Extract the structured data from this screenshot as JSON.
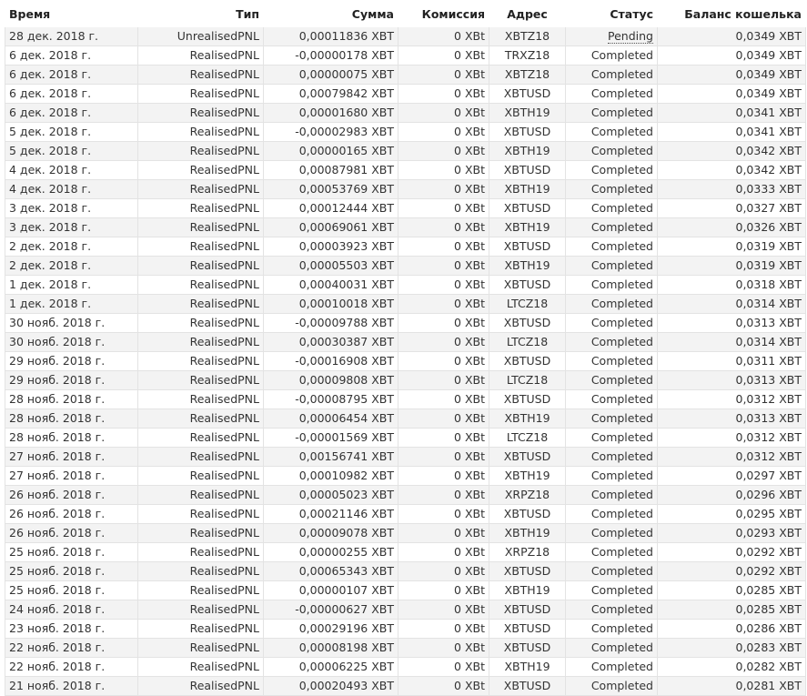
{
  "columns": {
    "time": "Время",
    "type": "Тип",
    "amount": "Сумма",
    "fee": "Комиссия",
    "address": "Адрес",
    "status": "Статус",
    "balance": "Баланс кошелька"
  },
  "rows": [
    {
      "time": "28 дек. 2018 г.",
      "type": "UnrealisedPNL",
      "amount": "0,00011836 XBT",
      "fee": "0 XBt",
      "address": "XBTZ18",
      "status": "Pending",
      "balance": "0,0349 XBT"
    },
    {
      "time": "6 дек. 2018 г.",
      "type": "RealisedPNL",
      "amount": "-0,00000178 XBT",
      "fee": "0 XBt",
      "address": "TRXZ18",
      "status": "Completed",
      "balance": "0,0349 XBT"
    },
    {
      "time": "6 дек. 2018 г.",
      "type": "RealisedPNL",
      "amount": "0,00000075 XBT",
      "fee": "0 XBt",
      "address": "XBTZ18",
      "status": "Completed",
      "balance": "0,0349 XBT"
    },
    {
      "time": "6 дек. 2018 г.",
      "type": "RealisedPNL",
      "amount": "0,00079842 XBT",
      "fee": "0 XBt",
      "address": "XBTUSD",
      "status": "Completed",
      "balance": "0,0349 XBT"
    },
    {
      "time": "6 дек. 2018 г.",
      "type": "RealisedPNL",
      "amount": "0,00001680 XBT",
      "fee": "0 XBt",
      "address": "XBTH19",
      "status": "Completed",
      "balance": "0,0341 XBT"
    },
    {
      "time": "5 дек. 2018 г.",
      "type": "RealisedPNL",
      "amount": "-0,00002983 XBT",
      "fee": "0 XBt",
      "address": "XBTUSD",
      "status": "Completed",
      "balance": "0,0341 XBT"
    },
    {
      "time": "5 дек. 2018 г.",
      "type": "RealisedPNL",
      "amount": "0,00000165 XBT",
      "fee": "0 XBt",
      "address": "XBTH19",
      "status": "Completed",
      "balance": "0,0342 XBT"
    },
    {
      "time": "4 дек. 2018 г.",
      "type": "RealisedPNL",
      "amount": "0,00087981 XBT",
      "fee": "0 XBt",
      "address": "XBTUSD",
      "status": "Completed",
      "balance": "0,0342 XBT"
    },
    {
      "time": "4 дек. 2018 г.",
      "type": "RealisedPNL",
      "amount": "0,00053769 XBT",
      "fee": "0 XBt",
      "address": "XBTH19",
      "status": "Completed",
      "balance": "0,0333 XBT"
    },
    {
      "time": "3 дек. 2018 г.",
      "type": "RealisedPNL",
      "amount": "0,00012444 XBT",
      "fee": "0 XBt",
      "address": "XBTUSD",
      "status": "Completed",
      "balance": "0,0327 XBT"
    },
    {
      "time": "3 дек. 2018 г.",
      "type": "RealisedPNL",
      "amount": "0,00069061 XBT",
      "fee": "0 XBt",
      "address": "XBTH19",
      "status": "Completed",
      "balance": "0,0326 XBT"
    },
    {
      "time": "2 дек. 2018 г.",
      "type": "RealisedPNL",
      "amount": "0,00003923 XBT",
      "fee": "0 XBt",
      "address": "XBTUSD",
      "status": "Completed",
      "balance": "0,0319 XBT"
    },
    {
      "time": "2 дек. 2018 г.",
      "type": "RealisedPNL",
      "amount": "0,00005503 XBT",
      "fee": "0 XBt",
      "address": "XBTH19",
      "status": "Completed",
      "balance": "0,0319 XBT"
    },
    {
      "time": "1 дек. 2018 г.",
      "type": "RealisedPNL",
      "amount": "0,00040031 XBT",
      "fee": "0 XBt",
      "address": "XBTUSD",
      "status": "Completed",
      "balance": "0,0318 XBT"
    },
    {
      "time": "1 дек. 2018 г.",
      "type": "RealisedPNL",
      "amount": "0,00010018 XBT",
      "fee": "0 XBt",
      "address": "LTCZ18",
      "status": "Completed",
      "balance": "0,0314 XBT"
    },
    {
      "time": "30 нояб. 2018 г.",
      "type": "RealisedPNL",
      "amount": "-0,00009788 XBT",
      "fee": "0 XBt",
      "address": "XBTUSD",
      "status": "Completed",
      "balance": "0,0313 XBT"
    },
    {
      "time": "30 нояб. 2018 г.",
      "type": "RealisedPNL",
      "amount": "0,00030387 XBT",
      "fee": "0 XBt",
      "address": "LTCZ18",
      "status": "Completed",
      "balance": "0,0314 XBT"
    },
    {
      "time": "29 нояб. 2018 г.",
      "type": "RealisedPNL",
      "amount": "-0,00016908 XBT",
      "fee": "0 XBt",
      "address": "XBTUSD",
      "status": "Completed",
      "balance": "0,0311 XBT"
    },
    {
      "time": "29 нояб. 2018 г.",
      "type": "RealisedPNL",
      "amount": "0,00009808 XBT",
      "fee": "0 XBt",
      "address": "LTCZ18",
      "status": "Completed",
      "balance": "0,0313 XBT"
    },
    {
      "time": "28 нояб. 2018 г.",
      "type": "RealisedPNL",
      "amount": "-0,00008795 XBT",
      "fee": "0 XBt",
      "address": "XBTUSD",
      "status": "Completed",
      "balance": "0,0312 XBT"
    },
    {
      "time": "28 нояб. 2018 г.",
      "type": "RealisedPNL",
      "amount": "0,00006454 XBT",
      "fee": "0 XBt",
      "address": "XBTH19",
      "status": "Completed",
      "balance": "0,0313 XBT"
    },
    {
      "time": "28 нояб. 2018 г.",
      "type": "RealisedPNL",
      "amount": "-0,00001569 XBT",
      "fee": "0 XBt",
      "address": "LTCZ18",
      "status": "Completed",
      "balance": "0,0312 XBT"
    },
    {
      "time": "27 нояб. 2018 г.",
      "type": "RealisedPNL",
      "amount": "0,00156741 XBT",
      "fee": "0 XBt",
      "address": "XBTUSD",
      "status": "Completed",
      "balance": "0,0312 XBT"
    },
    {
      "time": "27 нояб. 2018 г.",
      "type": "RealisedPNL",
      "amount": "0,00010982 XBT",
      "fee": "0 XBt",
      "address": "XBTH19",
      "status": "Completed",
      "balance": "0,0297 XBT"
    },
    {
      "time": "26 нояб. 2018 г.",
      "type": "RealisedPNL",
      "amount": "0,00005023 XBT",
      "fee": "0 XBt",
      "address": "XRPZ18",
      "status": "Completed",
      "balance": "0,0296 XBT"
    },
    {
      "time": "26 нояб. 2018 г.",
      "type": "RealisedPNL",
      "amount": "0,00021146 XBT",
      "fee": "0 XBt",
      "address": "XBTUSD",
      "status": "Completed",
      "balance": "0,0295 XBT"
    },
    {
      "time": "26 нояб. 2018 г.",
      "type": "RealisedPNL",
      "amount": "0,00009078 XBT",
      "fee": "0 XBt",
      "address": "XBTH19",
      "status": "Completed",
      "balance": "0,0293 XBT"
    },
    {
      "time": "25 нояб. 2018 г.",
      "type": "RealisedPNL",
      "amount": "0,00000255 XBT",
      "fee": "0 XBt",
      "address": "XRPZ18",
      "status": "Completed",
      "balance": "0,0292 XBT"
    },
    {
      "time": "25 нояб. 2018 г.",
      "type": "RealisedPNL",
      "amount": "0,00065343 XBT",
      "fee": "0 XBt",
      "address": "XBTUSD",
      "status": "Completed",
      "balance": "0,0292 XBT"
    },
    {
      "time": "25 нояб. 2018 г.",
      "type": "RealisedPNL",
      "amount": "0,00000107 XBT",
      "fee": "0 XBt",
      "address": "XBTH19",
      "status": "Completed",
      "balance": "0,0285 XBT"
    },
    {
      "time": "24 нояб. 2018 г.",
      "type": "RealisedPNL",
      "amount": "-0,00000627 XBT",
      "fee": "0 XBt",
      "address": "XBTUSD",
      "status": "Completed",
      "balance": "0,0285 XBT"
    },
    {
      "time": "23 нояб. 2018 г.",
      "type": "RealisedPNL",
      "amount": "0,00029196 XBT",
      "fee": "0 XBt",
      "address": "XBTUSD",
      "status": "Completed",
      "balance": "0,0286 XBT"
    },
    {
      "time": "22 нояб. 2018 г.",
      "type": "RealisedPNL",
      "amount": "0,00008198 XBT",
      "fee": "0 XBt",
      "address": "XBTUSD",
      "status": "Completed",
      "balance": "0,0283 XBT"
    },
    {
      "time": "22 нояб. 2018 г.",
      "type": "RealisedPNL",
      "amount": "0,00006225 XBT",
      "fee": "0 XBt",
      "address": "XBTH19",
      "status": "Completed",
      "balance": "0,0282 XBT"
    },
    {
      "time": "21 нояб. 2018 г.",
      "type": "RealisedPNL",
      "amount": "0,00020493 XBT",
      "fee": "0 XBt",
      "address": "XBTUSD",
      "status": "Completed",
      "balance": "0,0281 XBT"
    }
  ]
}
